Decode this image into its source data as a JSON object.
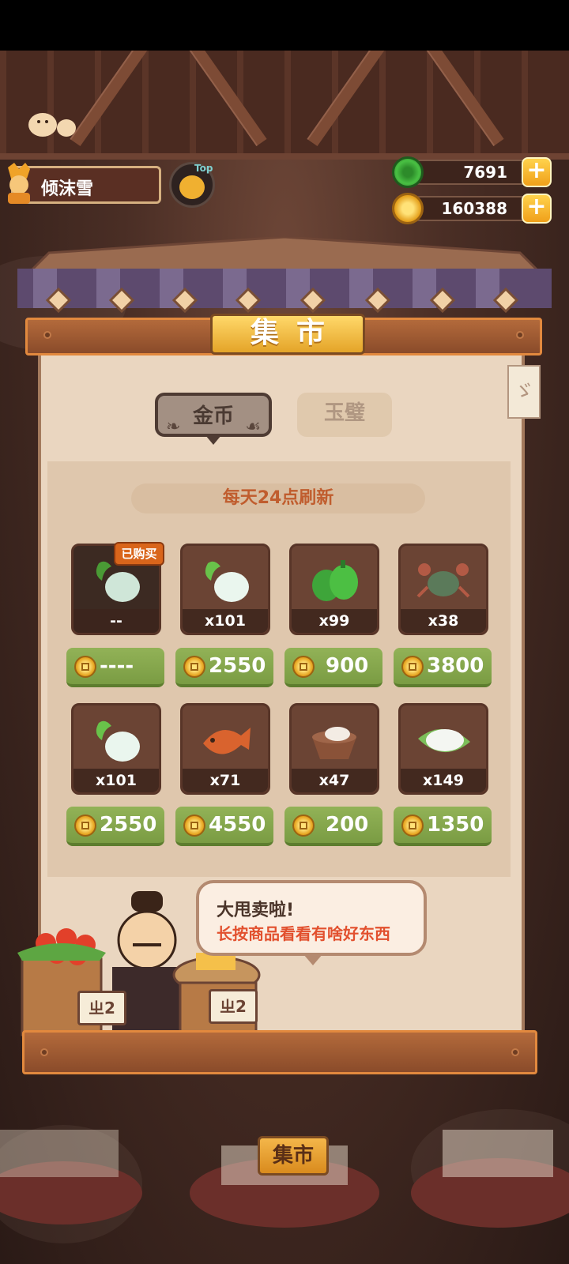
{
  "player": {
    "name": "倾沫雪",
    "badge_label": "Top"
  },
  "resources": [
    {
      "name": "jade",
      "value": "7691",
      "icon": "jade-icon",
      "color": "#3fae3a"
    },
    {
      "name": "coins",
      "value": "160388",
      "icon": "coin-icon",
      "color": "#f0b030"
    }
  ],
  "market": {
    "title": "集市",
    "tabs": [
      {
        "label": "金币",
        "active": true
      },
      {
        "label": "玉璧",
        "active": false
      }
    ],
    "refresh_notice": "每天24点刷新",
    "bought_badge": "已购买",
    "items": [
      {
        "name": "radish",
        "qty": "--",
        "price": "----",
        "bought": true
      },
      {
        "name": "radish",
        "qty": "x101",
        "price": "2550",
        "bought": false
      },
      {
        "name": "green-pepper",
        "qty": "x99",
        "price": "900",
        "bought": false
      },
      {
        "name": "crab",
        "qty": "x38",
        "price": "3800",
        "bought": false
      },
      {
        "name": "radish",
        "qty": "x101",
        "price": "2550",
        "bought": false
      },
      {
        "name": "fish",
        "qty": "x71",
        "price": "4550",
        "bought": false
      },
      {
        "name": "flour-bowl",
        "qty": "x47",
        "price": "200",
        "bought": false
      },
      {
        "name": "rice-leaf",
        "qty": "x149",
        "price": "1350",
        "bought": false
      }
    ],
    "merchant_speech": {
      "title": "大甩卖啦!",
      "subtitle": "长按商品看看有啥好东西"
    },
    "stall_signs": [
      "ㄓ2",
      "ㄓ2"
    ],
    "side_tag": "ゞ"
  },
  "bottom_sign": "集市"
}
